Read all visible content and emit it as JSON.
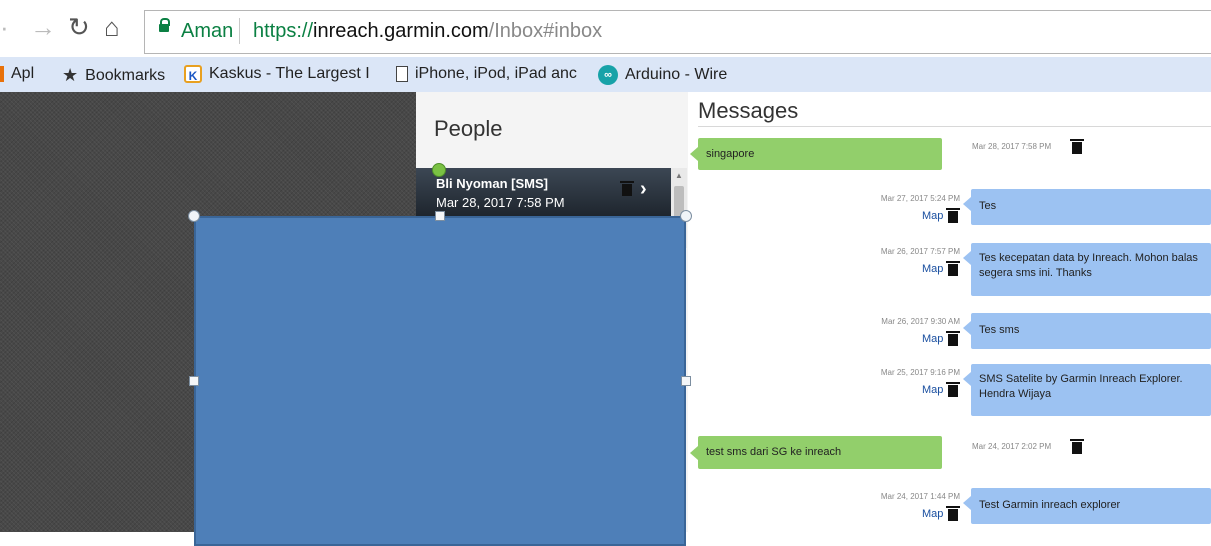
{
  "browser": {
    "url_secure_label": "Aman",
    "url_scheme": "https://",
    "url_host": "inreach.garmin.com",
    "url_path": "/Inbox#inbox",
    "icons": {
      "back": "back-arrow-icon",
      "forward": "forward-arrow-icon",
      "reload": "reload-icon",
      "home": "home-icon"
    }
  },
  "bookmarks": {
    "apps": "Apl",
    "bookmarks": "Bookmarks",
    "kaskus": "Kaskus - The Largest I",
    "iphone": "iPhone, iPod, iPad anc",
    "arduino": "Arduino - Wire"
  },
  "people": {
    "title": "People",
    "contact_name": "Bli Nyoman [SMS]",
    "contact_date": "Mar 28, 2017 7:58 PM"
  },
  "messages": {
    "title": "Messages",
    "map_label": "Map",
    "items": [
      {
        "direction": "incoming",
        "text": "singapore",
        "time": "Mar 28, 2017 7:58 PM"
      },
      {
        "direction": "outgoing",
        "text": "Tes",
        "time": "Mar 27, 2017 5:24 PM"
      },
      {
        "direction": "outgoing",
        "text": "Tes kecepatan data by Inreach. Mohon balas segera sms ini. Thanks",
        "time": "Mar 26, 2017 7:57 PM"
      },
      {
        "direction": "outgoing",
        "text": "Tes sms",
        "time": "Mar 26, 2017 9:30 AM"
      },
      {
        "direction": "outgoing",
        "text": "SMS Satelite by Garmin Inreach Explorer. Hendra Wijaya",
        "time": "Mar 25, 2017 9:16 PM"
      },
      {
        "direction": "incoming",
        "text": "test sms dari SG ke inreach",
        "time": "Mar 24, 2017 2:02 PM"
      },
      {
        "direction": "outgoing",
        "text": "Test Garmin inreach explorer",
        "time": "Mar 24, 2017 1:44 PM"
      }
    ]
  },
  "colors": {
    "incoming_bubble": "#92cf6b",
    "outgoing_bubble": "#9cc2f2",
    "overlay_rectangle": "#4e7fb8",
    "secure_green": "#0b8043"
  }
}
